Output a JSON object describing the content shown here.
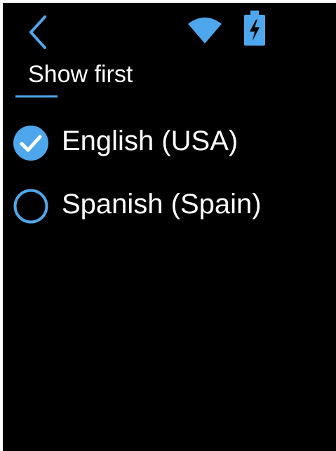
{
  "header": {
    "title": "Show first",
    "back_icon": "chevron-left-icon"
  },
  "status_bar": {
    "wifi_icon": "wifi-icon",
    "battery_icon": "battery-charging-icon"
  },
  "options": [
    {
      "label": "English (USA)",
      "selected": true
    },
    {
      "label": "Spanish (Spain)",
      "selected": false
    }
  ],
  "colors": {
    "accent": "#4ea7ec",
    "background": "#000000",
    "text": "#ffffff"
  }
}
